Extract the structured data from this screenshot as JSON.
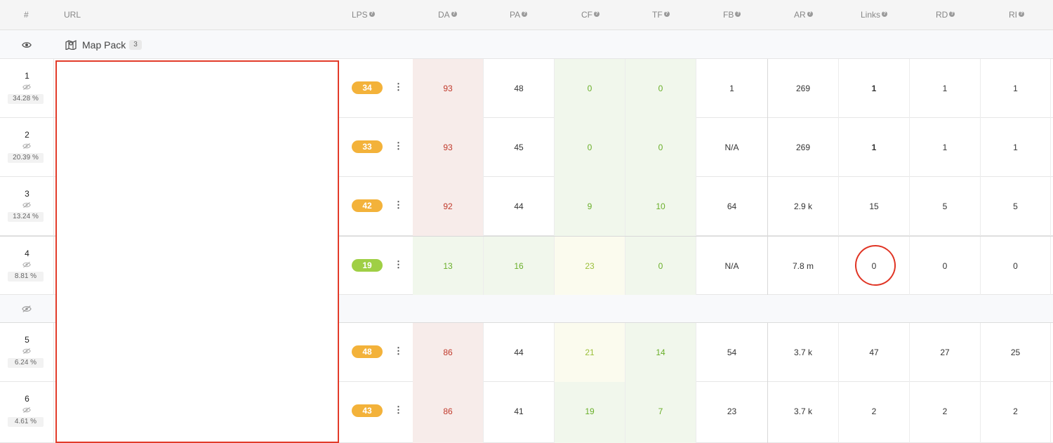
{
  "header": {
    "rank": "#",
    "url": "URL",
    "columns": [
      {
        "label": "LPS"
      },
      {
        "label": "DA"
      },
      {
        "label": "PA"
      },
      {
        "label": "CF"
      },
      {
        "label": "TF"
      },
      {
        "label": "FB"
      },
      {
        "label": "AR"
      },
      {
        "label": "Links"
      },
      {
        "label": "RD"
      },
      {
        "label": "RI"
      }
    ],
    "help_glyph": "?"
  },
  "map_pack": {
    "label": "Map Pack",
    "count": "3",
    "icon": "map-icon"
  },
  "rows": [
    {
      "rank": "1",
      "pct": "34.28 %",
      "lps": "34",
      "da": "93",
      "pa": "48",
      "cf": "0",
      "tf": "0",
      "fb": "1",
      "ar": "269",
      "links": "1",
      "rd": "1",
      "ri": "1"
    },
    {
      "rank": "2",
      "pct": "20.39 %",
      "lps": "33",
      "da": "93",
      "pa": "45",
      "cf": "0",
      "tf": "0",
      "fb": "N/A",
      "ar": "269",
      "links": "1",
      "rd": "1",
      "ri": "1"
    },
    {
      "rank": "3",
      "pct": "13.24 %",
      "lps": "42",
      "da": "92",
      "pa": "44",
      "cf": "9",
      "tf": "10",
      "fb": "64",
      "ar": "2.9 k",
      "links": "15",
      "rd": "5",
      "ri": "5"
    },
    {
      "rank": "4",
      "pct": "8.81 %",
      "lps": "19",
      "da": "13",
      "pa": "16",
      "cf": "23",
      "tf": "0",
      "fb": "N/A",
      "ar": "7.8 m",
      "links": "0",
      "rd": "0",
      "ri": "0"
    },
    {
      "rank": "5",
      "pct": "6.24 %",
      "lps": "48",
      "da": "86",
      "pa": "44",
      "cf": "21",
      "tf": "14",
      "fb": "54",
      "ar": "3.7 k",
      "links": "47",
      "rd": "27",
      "ri": "25"
    },
    {
      "rank": "6",
      "pct": "4.61 %",
      "lps": "43",
      "da": "86",
      "pa": "41",
      "cf": "19",
      "tf": "7",
      "fb": "23",
      "ar": "3.7 k",
      "links": "2",
      "rd": "2",
      "ri": "2"
    }
  ],
  "kebab_glyph": "⋮",
  "colors": {
    "lps_orange": "#f3b23a",
    "lps_green": "#9fcf45",
    "da_red": "#c0392b",
    "metric_green": "#6aaf2a",
    "annotation_red": "#e23b2a"
  }
}
